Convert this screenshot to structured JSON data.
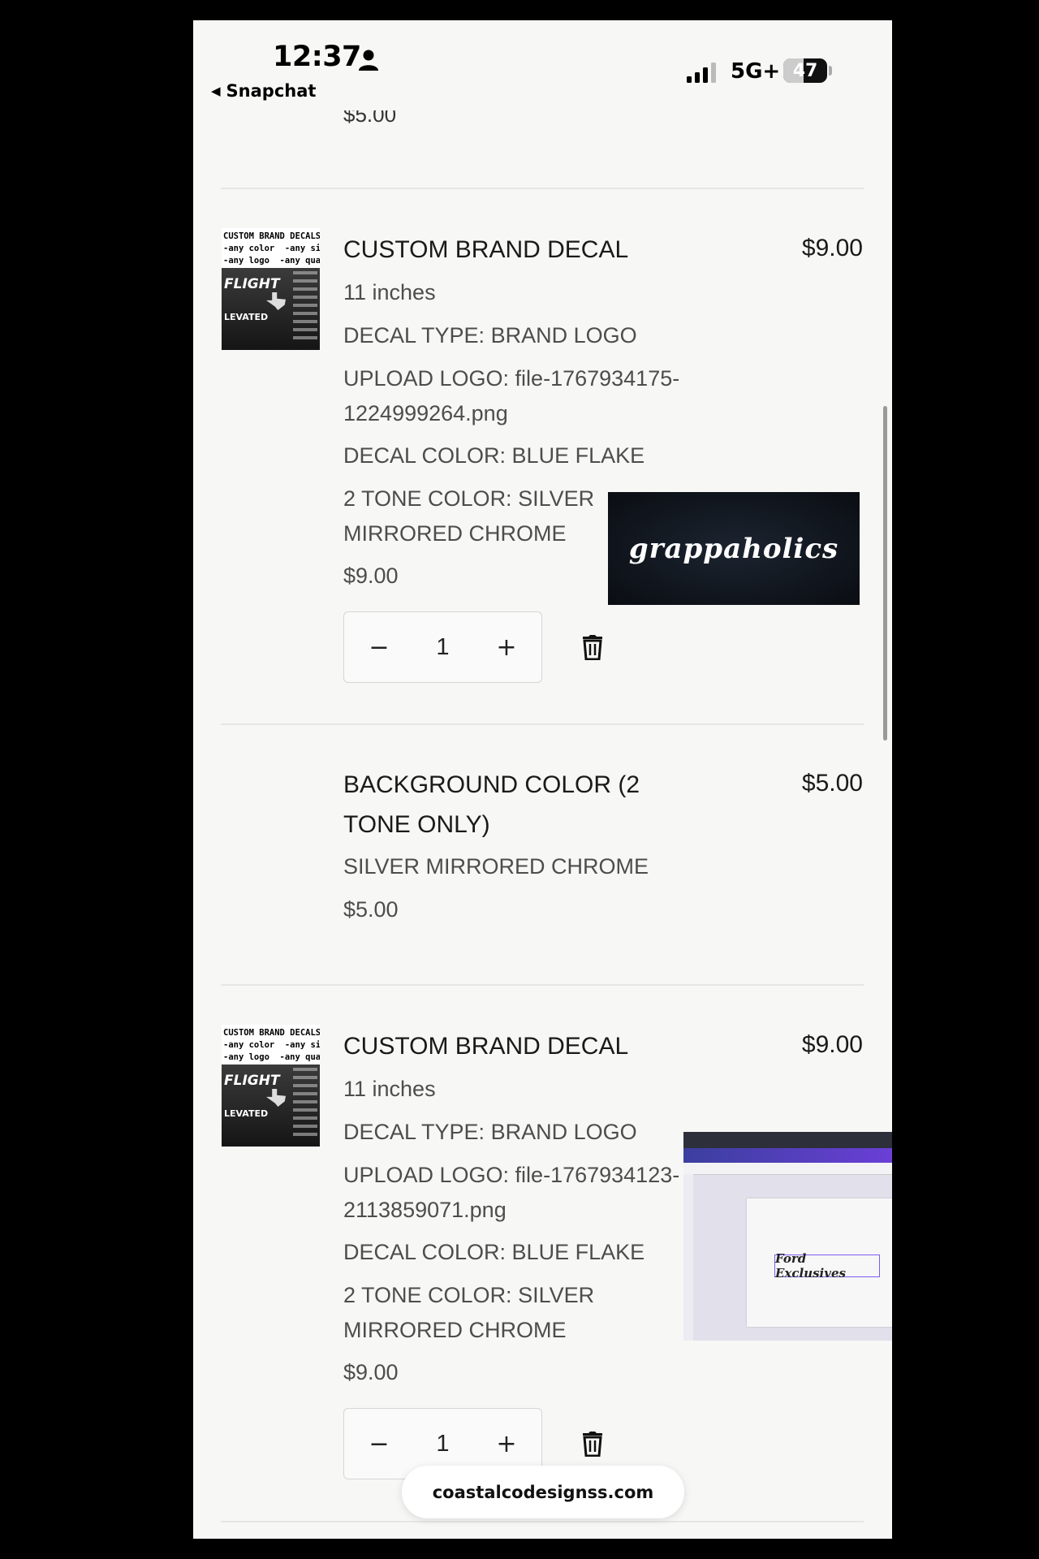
{
  "status_bar": {
    "time": "12:37",
    "back_app": "Snapchat",
    "network": "5G+",
    "battery": "47",
    "battery_percent": 47
  },
  "cart": {
    "partial_price": "$5.00",
    "items": [
      {
        "title": "CUSTOM BRAND DECAL",
        "line_price": "$9.00",
        "size": "11 inches",
        "decal_type": "DECAL TYPE: BRAND LOGO",
        "upload_logo_line1": "UPLOAD LOGO: file-1767934175-",
        "upload_logo_line2": "1224999264.png",
        "decal_color": "DECAL COLOR: BLUE FLAKE",
        "two_tone_line1": "2 TONE COLOR: SILVER",
        "two_tone_line2": "MIRRORED CHROME",
        "unit_price": "$9.00",
        "quantity": "1",
        "thumbnail": {
          "header": "CUSTOM BRAND DECALS\n-any color  -any size\n-any logo  -any quanity",
          "brand1": "FLIGHT",
          "brand2": "LEVATED"
        },
        "preview_text": "grappaholics"
      },
      {
        "title_line1": "BACKGROUND COLOR (2",
        "title_line2": "TONE ONLY)",
        "line_price": "$5.00",
        "option": "SILVER MIRRORED CHROME",
        "unit_price": "$5.00"
      },
      {
        "title": "CUSTOM BRAND DECAL",
        "line_price": "$9.00",
        "size": "11 inches",
        "decal_type": "DECAL TYPE: BRAND LOGO",
        "upload_logo_line1": "UPLOAD LOGO: file-1767934123-",
        "upload_logo_line2": "2113859071.png",
        "decal_color": "DECAL COLOR: BLUE FLAKE",
        "two_tone_line1": "2 TONE COLOR: SILVER",
        "two_tone_line2": "MIRRORED CHROME",
        "unit_price": "$9.00",
        "quantity": "1",
        "thumbnail": {
          "header": "CUSTOM BRAND DECALS\n-any color  -any size\n-any logo  -any quanity",
          "brand1": "FLIGHT",
          "brand2": "LEVATED"
        },
        "preview_text": "Ford Exclusives"
      }
    ],
    "minus_symbol": "−",
    "plus_symbol": "+"
  },
  "footer": {
    "domain": "coastalcodesignss.com"
  },
  "icons": {
    "person": "person-icon",
    "signal": "signal-icon",
    "trash": "trash-icon"
  }
}
